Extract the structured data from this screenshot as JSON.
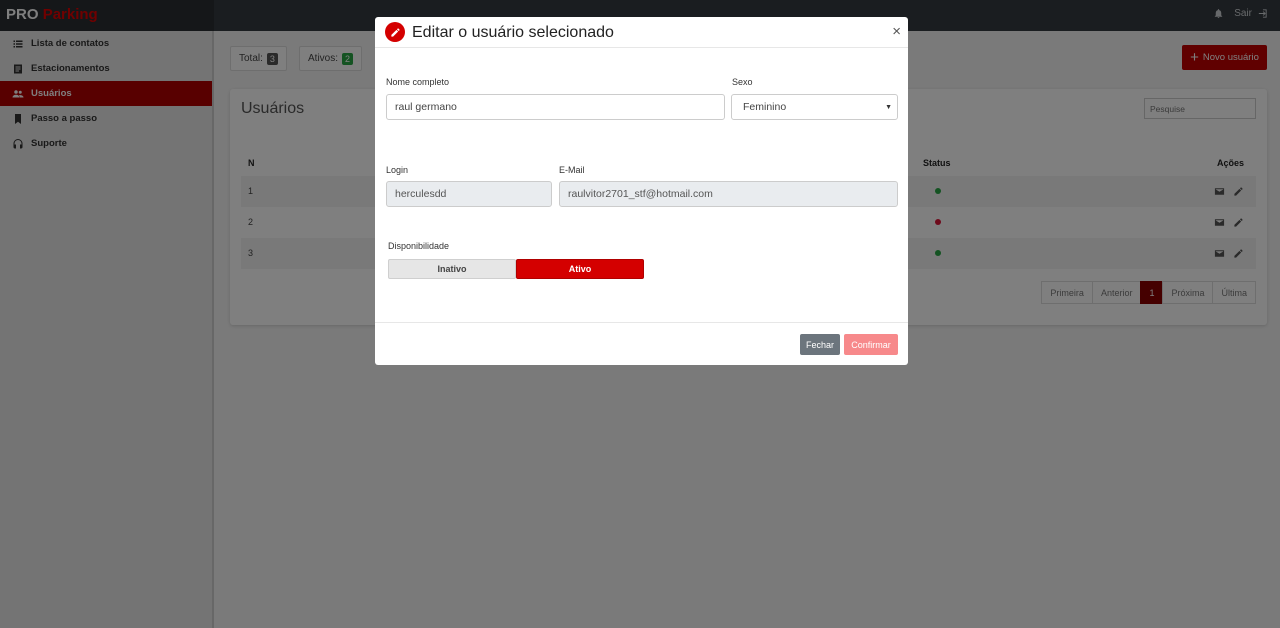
{
  "brand": {
    "pro": "PRO",
    "parking": "Parking"
  },
  "topbar": {
    "logout_label": "Sair"
  },
  "sidebar": {
    "items": [
      {
        "label": "Lista de contatos",
        "icon": "list-icon"
      },
      {
        "label": "Estacionamentos",
        "icon": "document-icon"
      },
      {
        "label": "Usuários",
        "icon": "users-icon",
        "active": true
      },
      {
        "label": "Passo a passo",
        "icon": "bookmark-icon"
      },
      {
        "label": "Suporte",
        "icon": "headset-icon"
      }
    ]
  },
  "stats": {
    "total_label": "Total:",
    "total_value": "3",
    "active_label": "Ativos:",
    "active_value": "2"
  },
  "new_user_label": "Novo usuário",
  "users_card": {
    "title": "Usuários",
    "search_placeholder": "Pesquise",
    "columns": {
      "n": "N",
      "status": "Status",
      "actions": "Ações"
    },
    "rows": [
      {
        "n": "1",
        "status": "active"
      },
      {
        "n": "2",
        "status": "inactive"
      },
      {
        "n": "3",
        "status": "active"
      }
    ],
    "pagination": {
      "first": "Primeira",
      "prev": "Anterior",
      "current": "1",
      "next": "Próxima",
      "last": "Última"
    }
  },
  "modal": {
    "title": "Editar o usuário selecionado",
    "close_symbol": "×",
    "fields": {
      "full_name_label": "Nome completo",
      "full_name_value": "raul germano",
      "sex_label": "Sexo",
      "sex_value": "Feminino",
      "login_label": "Login",
      "login_value": "herculesdd",
      "email_label": "E-Mail",
      "email_value": "raulvitor2701_stf@hotmail.com"
    },
    "availability": {
      "label": "Disponibilidade",
      "inactive": "Inativo",
      "active": "Ativo",
      "selected": "Ativo"
    },
    "buttons": {
      "close": "Fechar",
      "confirm": "Confirmar"
    }
  },
  "colors": {
    "brand_red": "#d40000",
    "sidebar_active": "#b00000",
    "status_active": "#28a745",
    "status_inactive": "#dc1436",
    "confirm": "#f7898b"
  }
}
